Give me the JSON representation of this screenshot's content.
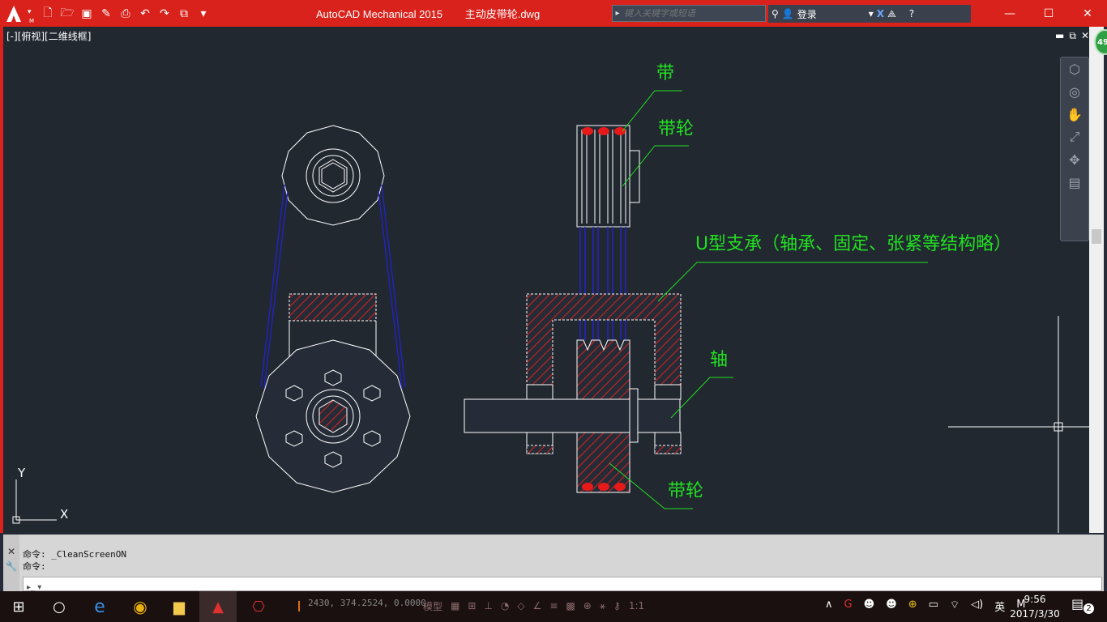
{
  "app": {
    "title": "AutoCAD Mechanical 2015",
    "filename": "主动皮带轮.dwg",
    "search_placeholder": "键入关键字或短语",
    "login_label": "登录",
    "brand_color": "#d9221c"
  },
  "viewport": {
    "label": "[-][俯视][二维线框]",
    "annotation_color": "#22e022"
  },
  "annotations": {
    "belt": "带",
    "pulley_top": "带轮",
    "u_support": "U型支承（轴承、固定、张紧等结构略）",
    "shaft": "轴",
    "pulley_bottom": "带轮"
  },
  "ucs": {
    "x_label": "X",
    "y_label": "Y"
  },
  "navbar_badge": "49",
  "command": {
    "line1": "命令: _CleanScreenON",
    "line2": "命令:",
    "prompt_icon": "command-prompt-icon"
  },
  "status": {
    "coords": "2430, 374.2524, 0.0000",
    "model_label": "模型",
    "scale_label": "1:1"
  },
  "taskbar": {
    "time": "9:56",
    "date": "2017/3/30",
    "ime_label": "英",
    "notification_count": "2"
  }
}
